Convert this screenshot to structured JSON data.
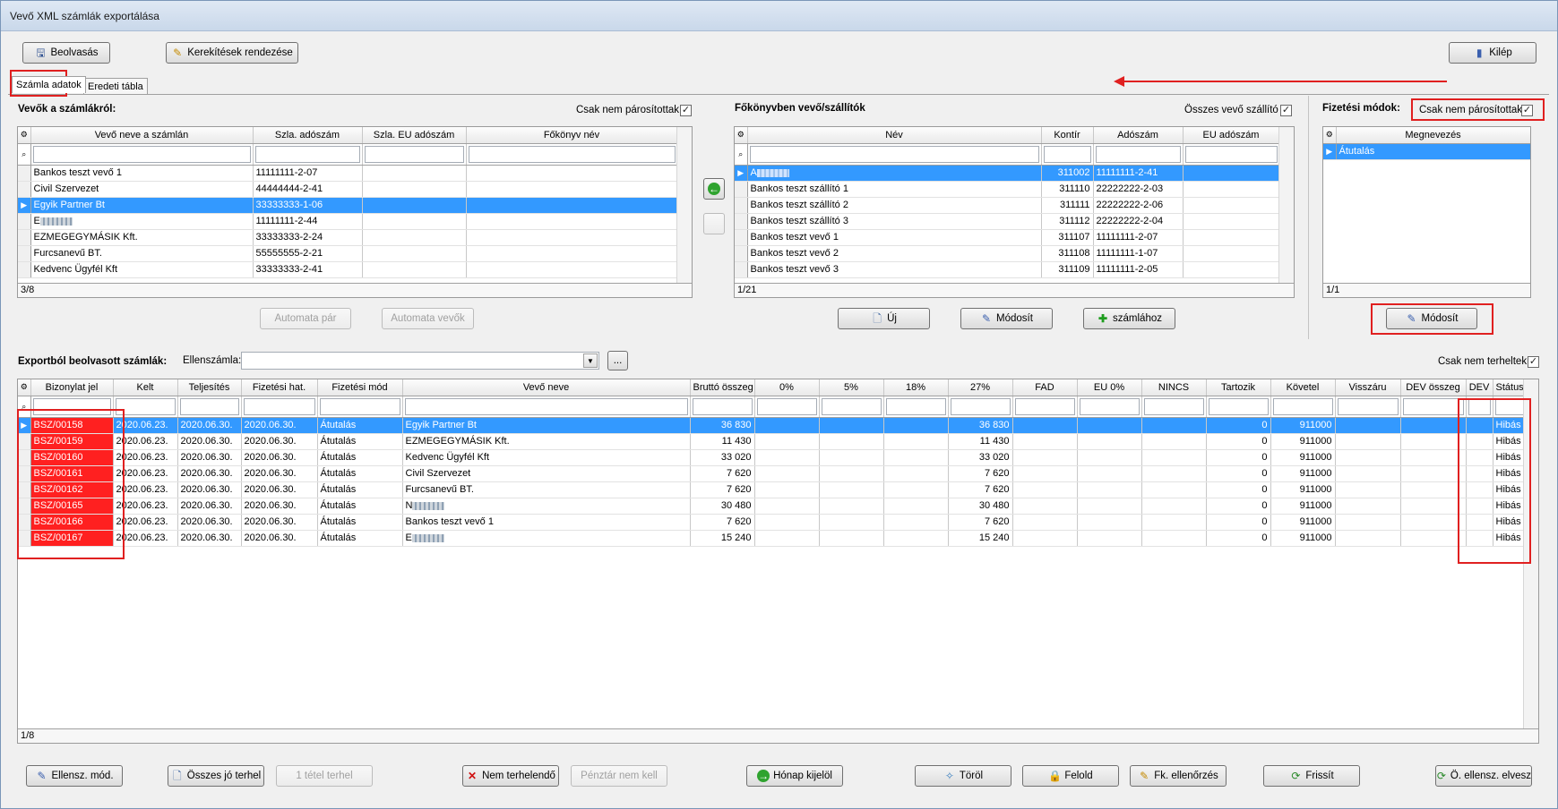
{
  "window": {
    "title": "Vevő XML számlák exportálása"
  },
  "toolbar": {
    "beolvasas": "Beolvasás",
    "kerekitesek": "Kerekítések rendezése",
    "kilep": "Kilép"
  },
  "tabs": [
    "Számla adatok",
    "Eredeti tábla"
  ],
  "customers": {
    "title": "Vevők a számlákról:",
    "only_unpaired_label": "Csak nem párosítottak",
    "only_unpaired_checked": true,
    "columns": [
      "Vevő neve a számlán",
      "Szla. adószám",
      "Szla. EU adószám",
      "Főkönyv név"
    ],
    "rows": [
      {
        "name": "Bankos teszt vevő 1",
        "tax": "11111111-2-07",
        "eu": "",
        "gl": ""
      },
      {
        "name": "Civil Szervezet",
        "tax": "44444444-2-41",
        "eu": "",
        "gl": ""
      },
      {
        "name": "Egyik Partner Bt",
        "tax": "33333333-1-06",
        "eu": "",
        "gl": ""
      },
      {
        "name": "E",
        "tax": "11111111-2-44",
        "eu": "",
        "gl": ""
      },
      {
        "name": "EZMEGEGYMÁSIK Kft.",
        "tax": "33333333-2-24",
        "eu": "",
        "gl": ""
      },
      {
        "name": "Furcsanevű BT.",
        "tax": "55555555-2-21",
        "eu": "",
        "gl": ""
      },
      {
        "name": "Kedvenc Ügyfél Kft",
        "tax": "33333333-2-41",
        "eu": "",
        "gl": ""
      }
    ],
    "selected_index": 2,
    "footer": "3/8",
    "btn_auto_pair": "Automata pár",
    "btn_auto_customers": "Automata vevők"
  },
  "ledger": {
    "title": "Főkönyvben vevő/szállítók",
    "all_label": "Összes vevő szállító",
    "all_checked": true,
    "columns": [
      "Név",
      "Kontír",
      "Adószám",
      "EU adószám"
    ],
    "rows": [
      {
        "name": "A",
        "kontir": "311002",
        "tax": "11111111-2-41",
        "eu": ""
      },
      {
        "name": "Bankos teszt szállító 1",
        "kontir": "311110",
        "tax": "22222222-2-03",
        "eu": ""
      },
      {
        "name": "Bankos teszt szállító 2",
        "kontir": "311111",
        "tax": "22222222-2-06",
        "eu": ""
      },
      {
        "name": "Bankos teszt szállító 3",
        "kontir": "311112",
        "tax": "22222222-2-04",
        "eu": ""
      },
      {
        "name": "Bankos teszt vevő 1",
        "kontir": "311107",
        "tax": "11111111-2-07",
        "eu": ""
      },
      {
        "name": "Bankos teszt vevő 2",
        "kontir": "311108",
        "tax": "11111111-1-07",
        "eu": ""
      },
      {
        "name": "Bankos teszt vevő 3",
        "kontir": "311109",
        "tax": "11111111-2-05",
        "eu": ""
      }
    ],
    "selected_index": 0,
    "footer": "1/21",
    "btn_new": "Új",
    "btn_modify": "Módosít",
    "btn_to_invoice": "számlához"
  },
  "payment": {
    "title": "Fizetési módok:",
    "only_unpaired_label": "Csak nem párosítottak",
    "only_unpaired_checked": true,
    "column": "Megnevezés",
    "rows": [
      "Átutalás"
    ],
    "footer": "1/1",
    "btn_modify": "Módosít"
  },
  "export": {
    "title": "Exportból beolvasott számlák:",
    "counter_label": "Ellenszámla:",
    "counter_value": "",
    "browse": "...",
    "only_unloaded_label": "Csak nem terheltek",
    "only_unloaded_checked": true,
    "columns": [
      "Bizonylat jel",
      "Kelt",
      "Teljesítés",
      "Fizetési hat.",
      "Fizetési mód",
      "Vevő neve",
      "Bruttó összeg",
      "0%",
      "5%",
      "18%",
      "27%",
      "FAD",
      "EU 0%",
      "NINCS",
      "Tartozik",
      "Követel",
      "Visszáru",
      "DEV összeg",
      "DEV",
      "Státusz"
    ],
    "rows": [
      {
        "doc": "BSZ/00158",
        "kelt": "2020.06.23.",
        "telj": "2020.06.30.",
        "hat": "2020.06.30.",
        "mod": "Átutalás",
        "vevo": "Egyik Partner Bt",
        "brutto": "36 830",
        "v27": "36 830",
        "tart": "0",
        "kov": "911000",
        "status": "Hibás"
      },
      {
        "doc": "BSZ/00159",
        "kelt": "2020.06.23.",
        "telj": "2020.06.30.",
        "hat": "2020.06.30.",
        "mod": "Átutalás",
        "vevo": "EZMEGEGYMÁSIK Kft.",
        "brutto": "11 430",
        "v27": "11 430",
        "tart": "0",
        "kov": "911000",
        "status": "Hibás"
      },
      {
        "doc": "BSZ/00160",
        "kelt": "2020.06.23.",
        "telj": "2020.06.30.",
        "hat": "2020.06.30.",
        "mod": "Átutalás",
        "vevo": "Kedvenc Ügyfél Kft",
        "brutto": "33 020",
        "v27": "33 020",
        "tart": "0",
        "kov": "911000",
        "status": "Hibás"
      },
      {
        "doc": "BSZ/00161",
        "kelt": "2020.06.23.",
        "telj": "2020.06.30.",
        "hat": "2020.06.30.",
        "mod": "Átutalás",
        "vevo": "Civil Szervezet",
        "brutto": "7 620",
        "v27": "7 620",
        "tart": "0",
        "kov": "911000",
        "status": "Hibás"
      },
      {
        "doc": "BSZ/00162",
        "kelt": "2020.06.23.",
        "telj": "2020.06.30.",
        "hat": "2020.06.30.",
        "mod": "Átutalás",
        "vevo": "Furcsanevű BT.",
        "brutto": "7 620",
        "v27": "7 620",
        "tart": "0",
        "kov": "911000",
        "status": "Hibás"
      },
      {
        "doc": "BSZ/00165",
        "kelt": "2020.06.23.",
        "telj": "2020.06.30.",
        "hat": "2020.06.30.",
        "mod": "Átutalás",
        "vevo": "N",
        "brutto": "30 480",
        "v27": "30 480",
        "tart": "0",
        "kov": "911000",
        "status": "Hibás"
      },
      {
        "doc": "BSZ/00166",
        "kelt": "2020.06.23.",
        "telj": "2020.06.30.",
        "hat": "2020.06.30.",
        "mod": "Átutalás",
        "vevo": "Bankos teszt vevő 1",
        "brutto": "7 620",
        "v27": "7 620",
        "tart": "0",
        "kov": "911000",
        "status": "Hibás"
      },
      {
        "doc": "BSZ/00167",
        "kelt": "2020.06.23.",
        "telj": "2020.06.30.",
        "hat": "2020.06.30.",
        "mod": "Átutalás",
        "vevo": "E",
        "brutto": "15 240",
        "v27": "15 240",
        "tart": "0",
        "kov": "911000",
        "status": "Hibás"
      }
    ],
    "footer": "1/8"
  },
  "bottom_buttons": {
    "ellensz_mod": "Ellensz. mód.",
    "osszes_jo": "Összes jó terhel",
    "egy_tetel": "1 tétel terhel",
    "nem_terhelendo": "Nem terhelendő",
    "penztar": "Pénztár nem kell",
    "honap": "Hónap kijelöl",
    "torol": "Töröl",
    "felold": "Felold",
    "fk_ell": "Fk. ellenőrzés",
    "frissit": "Frissít",
    "o_ellensz": "Ö. ellensz. elvesz"
  },
  "colors": {
    "selection": "#3399ff",
    "error_cell": "#ff2020",
    "annotation": "#e02020"
  }
}
